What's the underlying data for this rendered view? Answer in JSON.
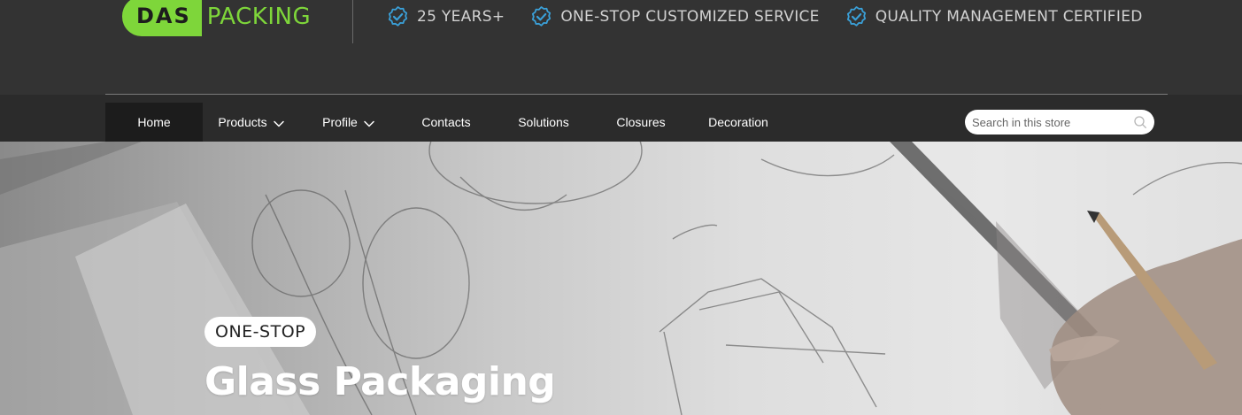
{
  "brand": {
    "logo_primary": "DAS",
    "logo_secondary": "PACKING",
    "accent_color": "#7ed63a"
  },
  "features": [
    {
      "icon": "verified-badge-icon",
      "label": "25 YEARS+"
    },
    {
      "icon": "verified-badge-icon",
      "label": "ONE-STOP CUSTOMIZED SERVICE"
    },
    {
      "icon": "verified-badge-icon",
      "label": "QUALITY MANAGEMENT CERTIFIED"
    }
  ],
  "nav": {
    "items": [
      {
        "label": "Home",
        "active": true,
        "dropdown": false
      },
      {
        "label": "Products",
        "active": false,
        "dropdown": true
      },
      {
        "label": "Profile",
        "active": false,
        "dropdown": true
      },
      {
        "label": "Contacts",
        "active": false,
        "dropdown": false
      },
      {
        "label": "Solutions",
        "active": false,
        "dropdown": false
      },
      {
        "label": "Closures",
        "active": false,
        "dropdown": false
      },
      {
        "label": "Decoration",
        "active": false,
        "dropdown": false
      }
    ],
    "search": {
      "placeholder": "Search in this store",
      "value": "",
      "icon": "search-icon"
    }
  },
  "hero": {
    "badge": "ONE-STOP",
    "title": "Glass Packaging"
  }
}
